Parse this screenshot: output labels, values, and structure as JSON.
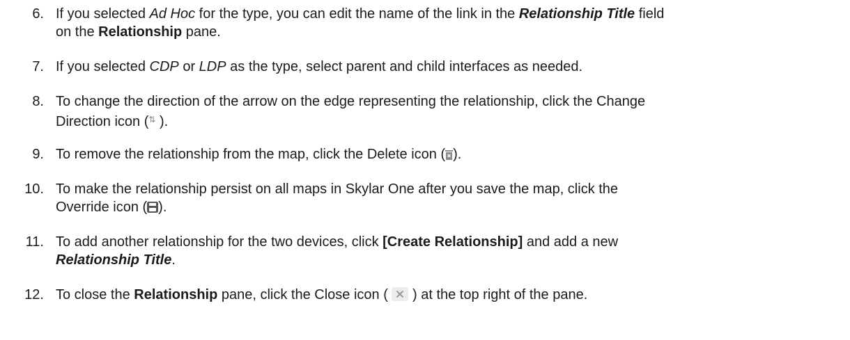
{
  "steps": [
    {
      "num": "6.",
      "parts": [
        "If you selected ",
        "Ad Hoc",
        " for the type, you can edit the name of the link in the ",
        "Relationship Title",
        " field",
        "on the ",
        "Relationship",
        " pane."
      ]
    },
    {
      "num": "7.",
      "parts": [
        "If you selected ",
        "CDP",
        " or ",
        "LDP",
        " as the type, select parent and child interfaces as needed."
      ]
    },
    {
      "num": "8.",
      "parts": [
        "To change the direction of the arrow on the edge representing the relationship, click the Change",
        "Direction icon (",
        " )."
      ],
      "icon": "change-direction-icon"
    },
    {
      "num": "9.",
      "parts": [
        "To remove the relationship from the map, click the Delete icon (",
        ")."
      ],
      "icon": "delete-icon"
    },
    {
      "num": "10.",
      "parts": [
        "To make the relationship persist on all maps in Skylar One after you save the map, click the",
        "Override icon (",
        ")."
      ],
      "icon": "override-icon"
    },
    {
      "num": "11.",
      "parts": [
        "To add another relationship for the two devices, click ",
        "[Create Relationship]",
        " and add a new",
        "Relationship Title",
        "."
      ]
    },
    {
      "num": "12.",
      "parts": [
        "To close the ",
        "Relationship",
        " pane, click the Close icon ( ",
        " ) at the top right of the pane."
      ],
      "icon": "close-icon"
    }
  ]
}
